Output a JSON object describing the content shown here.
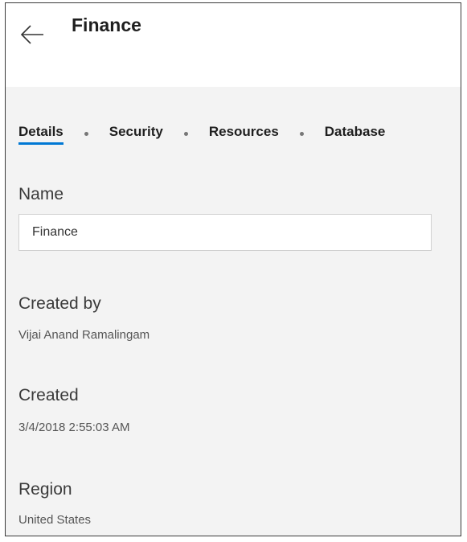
{
  "header": {
    "back_icon": "arrow-left-icon",
    "title": "Finance"
  },
  "tabs": [
    {
      "label": "Details",
      "active": true
    },
    {
      "label": "Security",
      "active": false
    },
    {
      "label": "Resources",
      "active": false
    },
    {
      "label": "Database",
      "active": false
    }
  ],
  "details": {
    "name_label": "Name",
    "name_value": "Finance",
    "created_by_label": "Created by",
    "created_by_value": "Vijai Anand Ramalingam",
    "created_label": "Created",
    "created_value": "3/4/2018 2:55:03 AM",
    "region_label": "Region",
    "region_value": "United States"
  },
  "colors": {
    "accent": "#0078d4",
    "panel_background": "#f3f3f3",
    "header_background": "#ffffff"
  }
}
